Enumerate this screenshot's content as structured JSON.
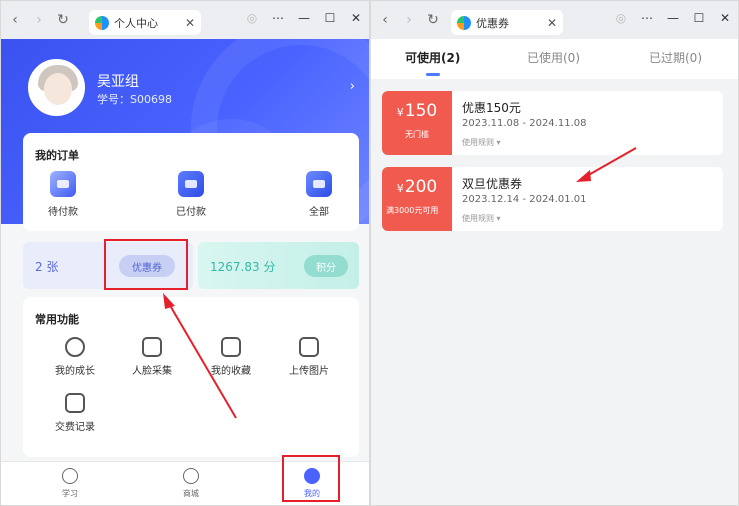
{
  "left_window": {
    "tab_title": "个人中心",
    "profile": {
      "name": "吴亚组",
      "student_id": "学号：S00698"
    },
    "orders": {
      "title": "我的订单",
      "items": [
        {
          "label": "待付款"
        },
        {
          "label": "已付款"
        },
        {
          "label": "全部"
        }
      ]
    },
    "coupon_stat": {
      "count": "2 张",
      "button": "优惠券"
    },
    "points_stat": {
      "value": "1267.83 分",
      "button": "积分"
    },
    "functions": {
      "title": "常用功能",
      "items": [
        {
          "label": "我的成长"
        },
        {
          "label": "人脸采集"
        },
        {
          "label": "我的收藏"
        },
        {
          "label": "上传图片"
        },
        {
          "label": "交费记录"
        }
      ]
    },
    "tabbar": [
      {
        "label": "学习"
      },
      {
        "label": "商城"
      },
      {
        "label": "我的"
      }
    ]
  },
  "right_window": {
    "tab_title": "优惠券",
    "segments": [
      {
        "label": "可使用(2)"
      },
      {
        "label": "已使用(0)"
      },
      {
        "label": "已过期(0)"
      }
    ],
    "coupons": [
      {
        "currency": "¥",
        "amount": "150",
        "condition": "无门槛",
        "title": "优惠150元",
        "date": "2023.11.08 - 2024.11.08",
        "rule": "使用规则 ▾"
      },
      {
        "currency": "¥",
        "amount": "200",
        "condition": "满3000元可用",
        "title": "双旦优惠券",
        "date": "2023.12.14 - 2024.01.01",
        "rule": "使用规则 ▾"
      }
    ]
  },
  "colors": {
    "brand_blue": "#4a63ff",
    "coupon_red": "#f05a4f",
    "annotation_red": "#e5202b"
  }
}
